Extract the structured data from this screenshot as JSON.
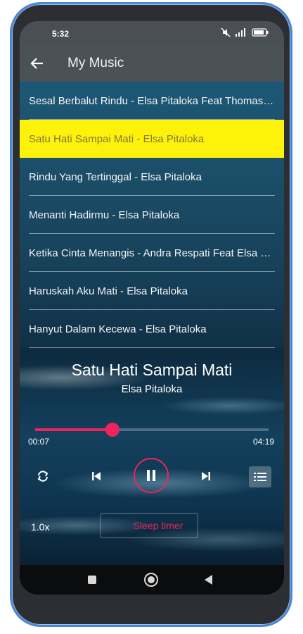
{
  "status": {
    "time": "5:32"
  },
  "header": {
    "title": "My Music"
  },
  "songs": [
    "Sesal Berbalut Rindu - Elsa Pitaloka Feat Thomas Arya",
    "Satu Hati Sampai Mati - Elsa Pitaloka",
    "Rindu Yang Tertinggal - Elsa Pitaloka",
    "Menanti Hadirmu - Elsa Pitaloka",
    "Ketika Cinta Menangis - Andra Respati Feat Elsa Pitaloka",
    "Haruskah Aku Mati - Elsa Pitaloka",
    "Hanyut Dalam Kecewa - Elsa Pitaloka"
  ],
  "active_index": 1,
  "now_playing": {
    "title": "Satu Hati Sampai Mati",
    "artist": "Elsa Pitaloka",
    "elapsed": "00:07",
    "total": "04:19",
    "progress": 0.33,
    "speed": "1.0x",
    "sleep_timer_label": "Sleep timer"
  },
  "colors": {
    "accent": "#f0235e",
    "highlight": "#fff20a"
  }
}
